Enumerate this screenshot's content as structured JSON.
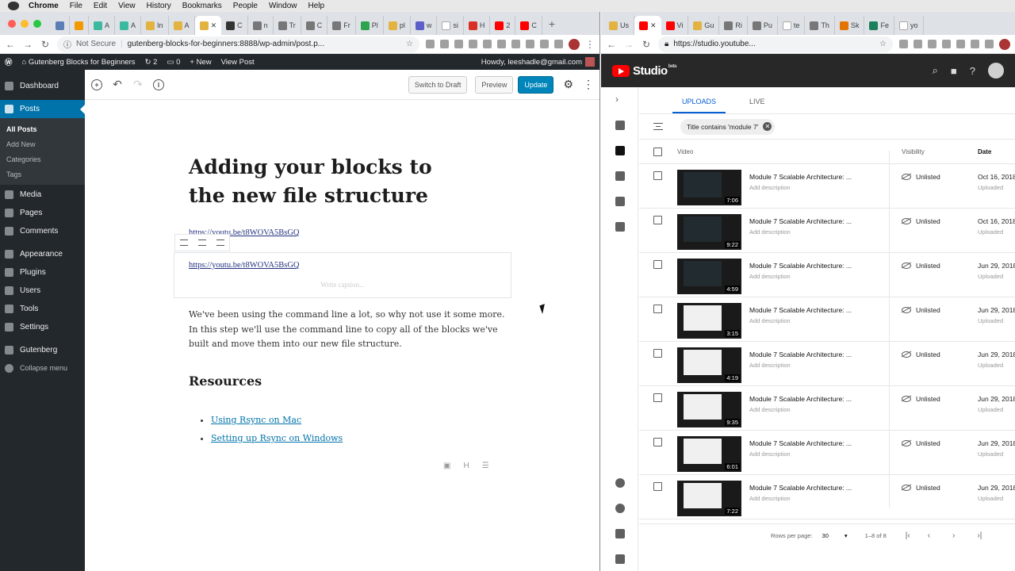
{
  "menubar": {
    "app": "Chrome",
    "items": [
      "File",
      "Edit",
      "View",
      "History",
      "Bookmarks",
      "People",
      "Window",
      "Help"
    ]
  },
  "left": {
    "tabs": [
      "A",
      "A",
      "In",
      "A",
      "",
      "C",
      "n",
      "Tr",
      "C",
      "Fr",
      "Pl",
      "pl",
      "w",
      "si",
      "H",
      "2",
      "C"
    ],
    "address": {
      "not_secure": "Not Secure",
      "url": "gutenberg-blocks-for-beginners:8888/wp-admin/post.p..."
    },
    "wpbar": {
      "site": "Gutenberg Blocks for Beginners",
      "updates": "2",
      "comments": "0",
      "new": "New",
      "view": "View Post",
      "howdy": "Howdy, leeshadle@gmail.com"
    },
    "sidebar": {
      "items": [
        "Dashboard",
        "Posts",
        "Media",
        "Pages",
        "Comments",
        "Appearance",
        "Plugins",
        "Users",
        "Tools",
        "Settings",
        "Gutenberg",
        "Collapse menu"
      ],
      "sub": [
        "All Posts",
        "Add New",
        "Categories",
        "Tags"
      ]
    },
    "toolbar": {
      "draft": "Switch to Draft",
      "preview": "Preview",
      "update": "Update"
    },
    "post": {
      "title": "Adding your blocks to the new file structure",
      "embed_url": "https://youtu.be/t8WOVA5BsGQ",
      "caption_placeholder": "Write caption...",
      "paragraph": "We've been using the command line a lot, so why not use it some more.  In this step we'll use the command line to copy all of the blocks we've built and move them into our new file structure.",
      "heading": "Resources",
      "links": [
        "Using Rsync on Mac",
        "Setting up Rsync on Windows"
      ]
    }
  },
  "right": {
    "tabs": [
      "Us",
      "Vi",
      "Gu",
      "Ri",
      "Pu",
      "te",
      "Th",
      "Sk",
      "Fe",
      "yo"
    ],
    "url": "https://studio.youtube...",
    "studio": {
      "title": "Studio",
      "beta": "beta",
      "tabs": [
        "UPLOADS",
        "LIVE"
      ],
      "filter": "Title contains 'module 7'",
      "cols": {
        "video": "Video",
        "visibility": "Visibility",
        "date": "Date"
      },
      "rows": [
        {
          "title": "Module 7 Scalable Architecture: ...",
          "desc": "Add description",
          "dur": "7:06",
          "vis": "Unlisted",
          "date": "Oct 16, 2018",
          "status": "Uploaded",
          "light": false
        },
        {
          "title": "Module 7 Scalable Architecture: ...",
          "desc": "Add description",
          "dur": "9:22",
          "vis": "Unlisted",
          "date": "Oct 16, 2018",
          "status": "Uploaded",
          "light": false
        },
        {
          "title": "Module 7 Scalable Architecture: ...",
          "desc": "Add description",
          "dur": "4:59",
          "vis": "Unlisted",
          "date": "Jun 29, 2018",
          "status": "Uploaded",
          "light": false
        },
        {
          "title": "Module 7 Scalable Architecture: ...",
          "desc": "Add description",
          "dur": "3:15",
          "vis": "Unlisted",
          "date": "Jun 29, 2018",
          "status": "Uploaded",
          "light": true
        },
        {
          "title": "Module 7 Scalable Architecture: ...",
          "desc": "Add description",
          "dur": "4:19",
          "vis": "Unlisted",
          "date": "Jun 29, 2018",
          "status": "Uploaded",
          "light": true
        },
        {
          "title": "Module 7 Scalable Architecture: ...",
          "desc": "Add description",
          "dur": "9:35",
          "vis": "Unlisted",
          "date": "Jun 29, 2018",
          "status": "Uploaded",
          "light": true
        },
        {
          "title": "Module 7 Scalable Architecture: ...",
          "desc": "Add description",
          "dur": "6:01",
          "vis": "Unlisted",
          "date": "Jun 29, 2018",
          "status": "Uploaded",
          "light": true
        },
        {
          "title": "Module 7 Scalable Architecture: ...",
          "desc": "Add description",
          "dur": "7:22",
          "vis": "Unlisted",
          "date": "Jun 29, 2018",
          "status": "Uploaded",
          "light": true
        }
      ],
      "footer": {
        "rows_label": "Rows per page:",
        "rows_value": "30",
        "range": "1–8 of 8"
      }
    }
  }
}
